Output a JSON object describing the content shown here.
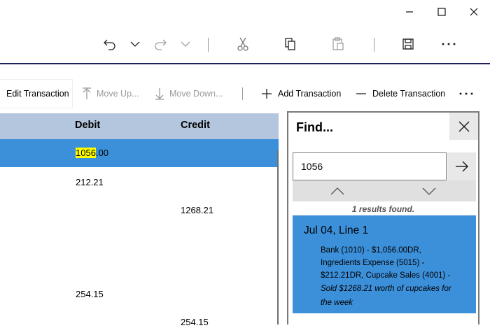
{
  "window": {
    "minimize": "minimize",
    "maximize": "maximize",
    "close": "close"
  },
  "toolbar": {
    "icons": [
      "undo-icon",
      "chevron-down-icon",
      "redo-icon",
      "chevron-down-icon",
      "cut-icon",
      "copy-icon",
      "paste-icon",
      "save-icon",
      "more-icon"
    ]
  },
  "commands": {
    "edit": "Edit Transaction",
    "move_up": "Move Up...",
    "move_down": "Move Down...",
    "add": "Add Transaction",
    "delete": "Delete Transaction",
    "more": "..."
  },
  "grid": {
    "headers": {
      "debit": "Debit",
      "credit": "Credit"
    },
    "rows": [
      {
        "debit_highlight": "1056",
        "debit_rest": ".00",
        "credit": ""
      },
      {
        "debit": "212.21",
        "credit": ""
      },
      {
        "debit": "",
        "credit": "1268.21"
      },
      {
        "debit": "",
        "credit": ""
      },
      {
        "debit": "254.15",
        "credit": ""
      },
      {
        "debit": "",
        "credit": "254.15"
      }
    ]
  },
  "find": {
    "title": "Find...",
    "query": "1056",
    "result_count": "1 results found.",
    "result": {
      "title": "Jul 04, Line 1",
      "accounts": "Bank (1010) - $1,056.00DR, Ingredients Expense (5015) - $212.21DR, Cupcake Sales (4001) -",
      "description": "Sold $1268.21 worth of cupcakes for the week"
    }
  },
  "colors": {
    "selection": "#3c8fd9",
    "header": "#b3c6de",
    "highlight": "#ffff00",
    "rule": "#1f1f5c"
  }
}
